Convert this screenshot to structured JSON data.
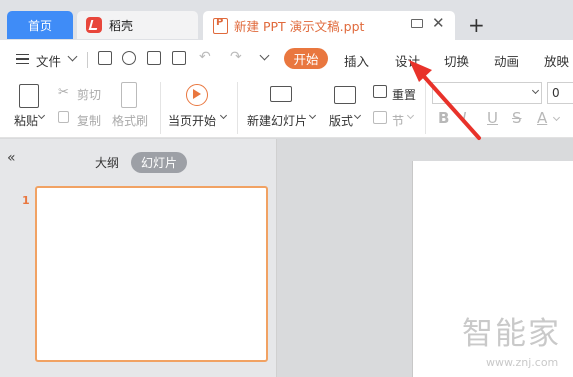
{
  "tabs": {
    "home": "首页",
    "wps": "稻壳",
    "document": "新建 PPT 演示文稿.ppt",
    "add": "+"
  },
  "menu": {
    "file": "文件",
    "start": "开始",
    "insert": "插入",
    "design": "设计",
    "transition": "切换",
    "animation": "动画",
    "slideshow": "放映"
  },
  "ribbon": {
    "paste": "粘贴",
    "cut": "剪切",
    "copy": "复制",
    "format_painter": "格式刷",
    "from_current": "当页开始",
    "new_slide": "新建幻灯片",
    "layout": "版式",
    "reset": "重置",
    "section": "节",
    "font_size": "0"
  },
  "panel": {
    "outline": "大纲",
    "slides": "幻灯片",
    "slide_number": "1"
  },
  "watermark": {
    "main": "智能家",
    "url": "www.znj.com"
  },
  "colors": {
    "accent": "#e9773f",
    "home_tab": "#3f8cf7",
    "arrow": "#e8322a"
  }
}
